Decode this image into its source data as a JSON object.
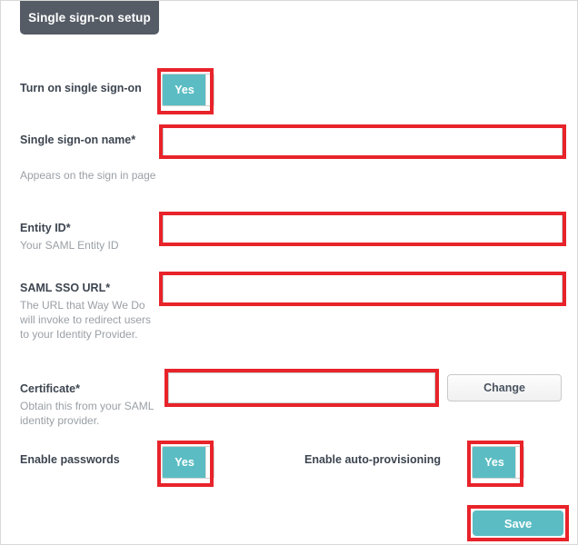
{
  "panel": {
    "tab_label": "Single sign-on setup"
  },
  "fields": {
    "sso_toggle": {
      "label": "Turn on single sign-on",
      "value": "Yes",
      "help": ""
    },
    "sso_name": {
      "label": "Single sign-on name*",
      "help": "Appears on the sign in page",
      "value": "",
      "placeholder": ""
    },
    "entity_id": {
      "label": "Entity ID*",
      "help": "Your SAML Entity ID",
      "value": "",
      "placeholder": ""
    },
    "saml_sso_url": {
      "label": "SAML SSO URL*",
      "help": "The URL that Way We Do will invoke to redirect users to your Identity Provider.",
      "value": "",
      "placeholder": ""
    },
    "certificate": {
      "label": "Certificate*",
      "help": "Obtain this from your SAML identity provider.",
      "value": "",
      "placeholder": "",
      "change_button": "Change"
    },
    "enable_passwords": {
      "label": "Enable passwords",
      "value": "Yes"
    },
    "enable_auto_provisioning": {
      "label": "Enable auto-provisioning",
      "value": "Yes"
    }
  },
  "actions": {
    "save_label": "Save"
  },
  "colors": {
    "accent_teal": "#5bbdc3",
    "tab_dark": "#565c66",
    "annotation_red": "#e8232a",
    "label_text": "#3d4550",
    "help_text": "#9aa0a6"
  }
}
